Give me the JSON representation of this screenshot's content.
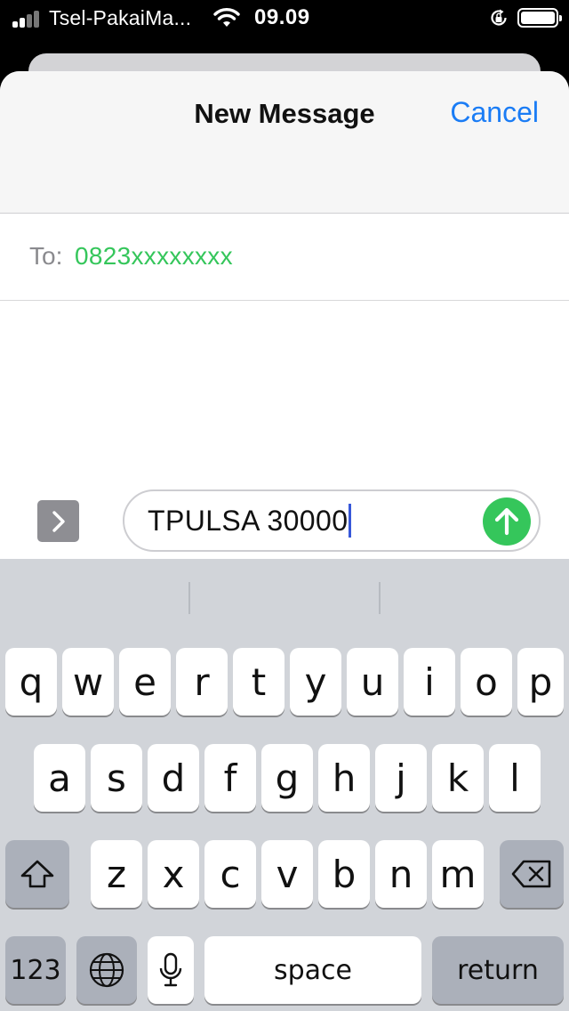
{
  "status_bar": {
    "carrier": "Tsel-PakaiMa...",
    "time": "09.09"
  },
  "header": {
    "title": "New Message",
    "cancel_label": "Cancel"
  },
  "recipient": {
    "label": "To:",
    "value": "0823xxxxxxxx"
  },
  "compose": {
    "message_text": "TPULSA 30000"
  },
  "keyboard": {
    "row1": [
      "q",
      "w",
      "e",
      "r",
      "t",
      "y",
      "u",
      "i",
      "o",
      "p"
    ],
    "row2": [
      "a",
      "s",
      "d",
      "f",
      "g",
      "h",
      "j",
      "k",
      "l"
    ],
    "row3": [
      "z",
      "x",
      "c",
      "v",
      "b",
      "n",
      "m"
    ],
    "numbers_label": "123",
    "space_label": "space",
    "return_label": "return"
  },
  "colors": {
    "accent_blue": "#1a7cf5",
    "recipient_green": "#35c65b",
    "send_green": "#35c65b",
    "keyboard_bg": "#d1d4d9"
  }
}
